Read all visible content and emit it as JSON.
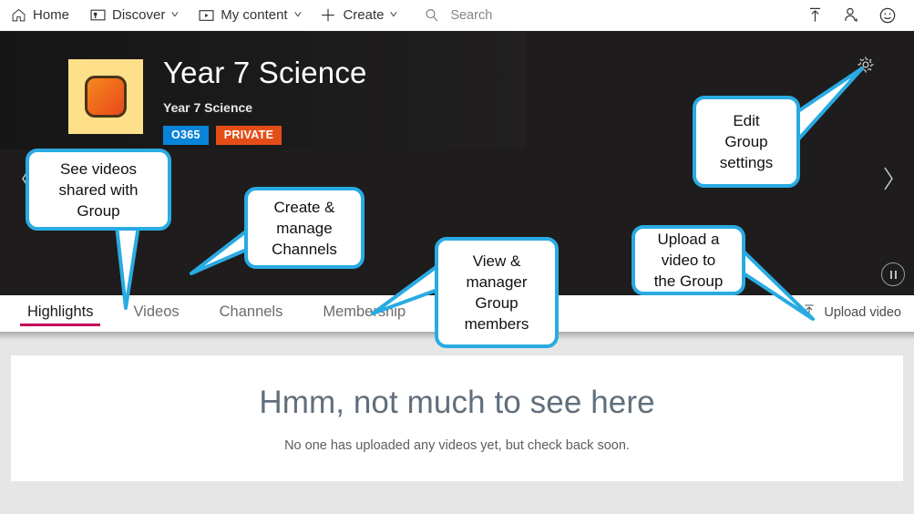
{
  "topnav": {
    "items": [
      {
        "label": "Home",
        "icon": "home-icon",
        "caret": false
      },
      {
        "label": "Discover",
        "icon": "discover-icon",
        "caret": true
      },
      {
        "label": "My content",
        "icon": "my-content-icon",
        "caret": true
      },
      {
        "label": "Create",
        "icon": "plus-icon",
        "caret": true
      }
    ],
    "search": {
      "placeholder": "Search",
      "value": "",
      "icon": "search-icon"
    },
    "actions": [
      {
        "name": "upload-icon"
      },
      {
        "name": "add-person-icon"
      },
      {
        "name": "smiley-feedback-icon"
      }
    ]
  },
  "hero": {
    "title": "Year 7 Science",
    "subtitle": "Year 7 Science",
    "badges": [
      {
        "label": "O365",
        "color": "#0a84d8"
      },
      {
        "label": "PRIVATE",
        "color": "#e44d17"
      }
    ],
    "thumbnail_name": "group-thumbnail",
    "gear_icon": "gear-icon",
    "prev_icon": "chevron-left-icon",
    "next_icon": "chevron-right-icon",
    "pause_icon": "pause-icon",
    "background": "#1e1c1c"
  },
  "tabbar": {
    "tabs": [
      {
        "label": "Highlights",
        "active": true
      },
      {
        "label": "Videos",
        "active": false
      },
      {
        "label": "Channels",
        "active": false
      },
      {
        "label": "Membership",
        "active": false
      }
    ],
    "active_underline_color": "#c4005a",
    "upload": {
      "label": "Upload video",
      "icon": "upload-icon"
    }
  },
  "main": {
    "empty_title": "Hmm, not much to see here",
    "empty_body": "No one has uploaded any videos yet, but check back soon."
  },
  "callouts": {
    "border_color": "#29abe2",
    "items": [
      {
        "id": "see-videos",
        "text": "See videos\nshared with\nGroup"
      },
      {
        "id": "create-channels",
        "text": "Create &\nmanage\nChannels"
      },
      {
        "id": "view-members",
        "text": "View &\nmanager\nGroup\nmembers"
      },
      {
        "id": "upload-video",
        "text": "Upload a\nvideo to\nthe Group"
      },
      {
        "id": "edit-settings",
        "text": "Edit\nGroup\nsettings"
      }
    ]
  }
}
